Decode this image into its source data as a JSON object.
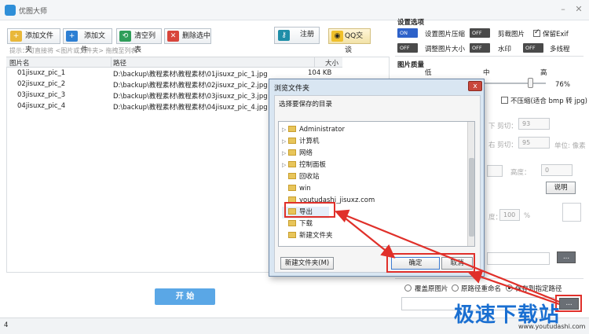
{
  "window": {
    "title": "优图大师",
    "minimize": "–",
    "close": "✕"
  },
  "toolbar": {
    "add_folder": "添加文件夹",
    "add_file": "添加文件",
    "clear_list": "清空列表",
    "delete_selected": "删除选中",
    "register": "注册",
    "qq": "QQ交谈"
  },
  "hint": "提示：可直接将 <图片或文件夹> 拖拽至列表",
  "table": {
    "columns": [
      "图片名",
      "路径",
      "大小"
    ],
    "rows": [
      {
        "name": "01jisuxz_pic_1",
        "path": "D:\\backup\\教程素材\\教程素材\\01jisuxz_pic_1.jpg",
        "size": "104 KB"
      },
      {
        "name": "02jisuxz_pic_2",
        "path": "D:\\backup\\教程素材\\教程素材\\02jisuxz_pic_2.jpg",
        "size": ""
      },
      {
        "name": "03jisuxz_pic_3",
        "path": "D:\\backup\\教程素材\\教程素材\\03jisuxz_pic_3.jpg",
        "size": ""
      },
      {
        "name": "04jisuxz_pic_4",
        "path": "D:\\backup\\教程素材\\教程素材\\04jisuxz_pic_4.jpg",
        "size": ""
      }
    ]
  },
  "settings": {
    "section_title": "设置选项",
    "options": [
      {
        "toggle": "ON",
        "label": "设置图片压缩"
      },
      {
        "toggle": "OFF",
        "label": "剪裁图片"
      },
      {
        "checkbox": true,
        "label": "保留Exif"
      },
      {
        "toggle": "OFF",
        "label": "调整图片大小"
      },
      {
        "toggle": "OFF",
        "label": "水印"
      },
      {
        "toggle": "OFF",
        "label": "多线程"
      }
    ],
    "quality_title": "图片质量",
    "quality_low": "低",
    "quality_mid": "中",
    "quality_high": "高",
    "quality_value": "76%",
    "quality_fraction": 0.76,
    "no_compress": "不压缩(适合 bmp 转 jpg)",
    "crop_bottom_label": "下 剪切：",
    "crop_bottom_value": "93",
    "crop_right_label": "右 剪切：",
    "crop_right_value": "95",
    "unit_label": "单位: 像素",
    "height_label": "高度：",
    "height_value": "0",
    "explain_button": "说明",
    "degree_label": "度：",
    "degree_value": "100",
    "percent": "%",
    "browse_button": "...",
    "save_options": [
      {
        "label": "覆盖原图片",
        "checked": false
      },
      {
        "label": "原路径重命名",
        "checked": false
      },
      {
        "label": "保存到指定路径",
        "checked": true
      }
    ]
  },
  "start_button": "开 始",
  "status": {
    "count": "4"
  },
  "dialog": {
    "title": "浏览文件夹",
    "close": "x",
    "prompt": "选择要保存的目录",
    "tree": [
      {
        "label": "Administrator",
        "arrow": "▷",
        "indent": 0
      },
      {
        "label": "计算机",
        "arrow": "▷",
        "indent": 0
      },
      {
        "label": "网络",
        "arrow": "▷",
        "indent": 0
      },
      {
        "label": "控制面板",
        "arrow": "▷",
        "indent": 0
      },
      {
        "label": "回收站",
        "arrow": "",
        "indent": 0
      },
      {
        "label": "win",
        "arrow": "",
        "indent": 0
      },
      {
        "label": "youtudashi_jisuxz.com",
        "arrow": "",
        "indent": 0
      },
      {
        "label": "导出",
        "arrow": "",
        "indent": 0,
        "selected": true
      },
      {
        "label": "下载",
        "arrow": "",
        "indent": 0
      },
      {
        "label": "新建文件夹",
        "arrow": "",
        "indent": 0
      }
    ],
    "new_folder_button": "新建文件夹(M)",
    "ok_button": "确定",
    "cancel_button": "取消"
  },
  "watermark": {
    "brand": "极速下载站",
    "url": "www.youtudashi.com"
  },
  "colors": {
    "accent": "#2e62c9",
    "start": "#5aa7e6",
    "annotation": "#e0302a"
  }
}
